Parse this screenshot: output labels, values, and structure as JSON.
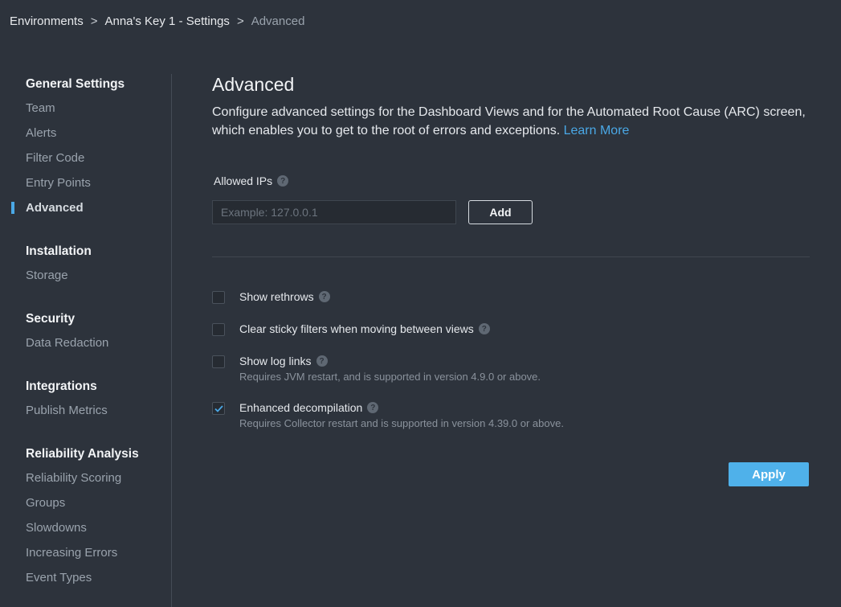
{
  "breadcrumb": {
    "items": [
      "Environments",
      "Anna's Key 1 - Settings",
      "Advanced"
    ],
    "separator": ">"
  },
  "sidebar": {
    "groups": [
      {
        "heading": "General Settings",
        "items": [
          "Team",
          "Alerts",
          "Filter Code",
          "Entry Points",
          "Advanced"
        ]
      },
      {
        "heading": "Installation",
        "items": [
          "Storage"
        ]
      },
      {
        "heading": "Security",
        "items": [
          "Data Redaction"
        ]
      },
      {
        "heading": "Integrations",
        "items": [
          "Publish Metrics"
        ]
      },
      {
        "heading": "Reliability Analysis",
        "items": [
          "Reliability Scoring",
          "Groups",
          "Slowdowns",
          "Increasing Errors",
          "Event Types"
        ]
      }
    ],
    "active_item": "Advanced"
  },
  "main": {
    "title": "Advanced",
    "description": "Configure advanced settings for the Dashboard Views and for the Automated Root Cause (ARC) screen, which enables you to get to the root of errors and exceptions.",
    "learn_more": "Learn More",
    "allowed_ips": {
      "label": "Allowed IPs",
      "placeholder": "Example: 127.0.0.1",
      "value": "",
      "add_label": "Add"
    },
    "help_glyph": "?",
    "options": [
      {
        "label": "Show rethrows",
        "sub": "",
        "checked": false
      },
      {
        "label": "Clear sticky filters when moving between views",
        "sub": "",
        "checked": false
      },
      {
        "label": "Show log links",
        "sub": "Requires JVM restart, and is supported in version 4.9.0 or above.",
        "checked": false
      },
      {
        "label": "Enhanced decompilation",
        "sub": "Requires Collector restart and is supported in version 4.39.0 or above.",
        "checked": true
      }
    ],
    "apply_label": "Apply"
  },
  "colors": {
    "background": "#2d333c",
    "accent": "#4aa8e6",
    "apply": "#4fb1ea"
  }
}
